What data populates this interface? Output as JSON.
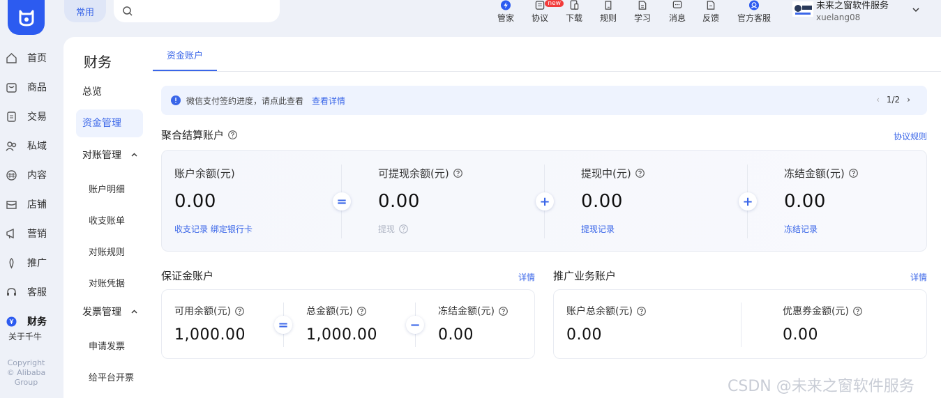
{
  "topbar": {
    "common_label": "常用",
    "search_placeholder": "",
    "nav": [
      {
        "label": "管家",
        "icon": "butler-icon",
        "badge": ""
      },
      {
        "label": "协议",
        "icon": "agreement-icon",
        "badge": "new"
      },
      {
        "label": "下载",
        "icon": "download-icon",
        "badge": ""
      },
      {
        "label": "规则",
        "icon": "rules-icon",
        "badge": ""
      },
      {
        "label": "学习",
        "icon": "learn-icon",
        "badge": ""
      },
      {
        "label": "消息",
        "icon": "message-icon",
        "badge": ""
      },
      {
        "label": "反馈",
        "icon": "feedback-icon",
        "badge": ""
      },
      {
        "label": "官方客服",
        "icon": "support-icon",
        "badge": ""
      }
    ],
    "user": {
      "shop_name": "未来之窗软件服务",
      "account": "xuelang08"
    }
  },
  "sidebar": {
    "items": [
      {
        "label": "首页",
        "icon": "home-icon"
      },
      {
        "label": "商品",
        "icon": "goods-icon"
      },
      {
        "label": "交易",
        "icon": "trade-icon"
      },
      {
        "label": "私域",
        "icon": "private-domain-icon"
      },
      {
        "label": "内容",
        "icon": "content-icon"
      },
      {
        "label": "店铺",
        "icon": "shop-icon"
      },
      {
        "label": "营销",
        "icon": "marketing-icon"
      },
      {
        "label": "推广",
        "icon": "promotion-icon"
      },
      {
        "label": "客服",
        "icon": "customer-service-icon"
      },
      {
        "label": "财务",
        "icon": "finance-icon"
      }
    ],
    "footer": "关于千牛",
    "copyright": [
      "Copyright",
      "© Alibaba",
      "Group"
    ]
  },
  "subnav": {
    "title": "财务",
    "overview": "总览",
    "funds": "资金管理",
    "reconcile": "对账管理",
    "reconcile_items": [
      "账户明细",
      "收支账单",
      "对账规则",
      "对账凭据"
    ],
    "invoice": "发票管理",
    "invoice_items": [
      "申请发票",
      "给平台开票"
    ]
  },
  "main": {
    "tab": "资金账户",
    "notice": {
      "text": "微信支付签约进度，请点此查看",
      "link": "查看详情",
      "page": "1/2"
    },
    "aggregate": {
      "title": "聚合结算账户",
      "agreement_link": "协议规则",
      "balance": {
        "label": "账户余额(元)",
        "value": "0.00",
        "act1": "收支记录",
        "act2": "绑定银行卡"
      },
      "withdrawable": {
        "label": "可提现余额(元)",
        "value": "0.00",
        "act": "提现"
      },
      "withdrawing": {
        "label": "提现中(元)",
        "value": "0.00",
        "act": "提现记录"
      },
      "frozen": {
        "label": "冻结金额(元)",
        "value": "0.00",
        "act": "冻结记录"
      },
      "ops": [
        "=",
        "+",
        "+"
      ]
    },
    "deposit": {
      "title": "保证金账户",
      "detail": "详情",
      "available": {
        "label": "可用余额(元)",
        "value": "1,000.00"
      },
      "total": {
        "label": "总金额(元)",
        "value": "1,000.00"
      },
      "frozen": {
        "label": "冻结金额(元)",
        "value": "0.00"
      },
      "ops": [
        "=",
        "−"
      ]
    },
    "promo": {
      "title": "推广业务账户",
      "detail": "详情",
      "total": {
        "label": "账户总余额(元)",
        "value": "0.00"
      },
      "coupon": {
        "label": "优惠券金额(元)",
        "value": "0.00"
      }
    }
  },
  "watermark": "CSDN @未来之窗软件服务",
  "colors": {
    "accent": "#3a66e8",
    "logo": "#2c5bf0",
    "bg": "#eef1f8"
  }
}
